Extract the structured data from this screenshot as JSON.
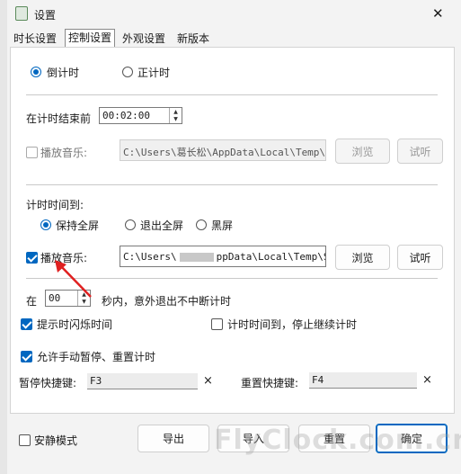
{
  "window": {
    "title": "设置",
    "close_glyph": "✕"
  },
  "tabs": [
    "时长设置",
    "控制设置",
    "外观设置",
    "新版本"
  ],
  "mode": {
    "countdown": "倒计时",
    "countup": "正计时",
    "selected": "countdown"
  },
  "before_end": {
    "label": "在计时结束前",
    "time": "00:02:00"
  },
  "music_before": {
    "label": "播放音乐:",
    "path": "C:\\Users\\葛长松\\AppData\\Local\\Temp\\ti",
    "browse": "浏览",
    "preview": "试听",
    "checked": false
  },
  "on_end": {
    "label": "计时时间到:",
    "options": [
      "保持全屏",
      "退出全屏",
      "黑屏"
    ],
    "selected": 0,
    "music_label": "播放音乐:",
    "music_path": "C:\\Users\\",
    "music_path_tail": "ppData\\Local\\Temp\\St",
    "browse": "浏览",
    "preview": "试听",
    "music_checked": true
  },
  "inactivity": {
    "prefix": "在",
    "value": "00",
    "suffix": "秒内，意外退出不中断计时"
  },
  "options": {
    "flash": {
      "label": "提示时闪烁时间",
      "checked": true
    },
    "stop_on_end": {
      "label": "计时时间到，停止继续计时",
      "checked": false
    },
    "manual": {
      "label": "允许手动暂停、重置计时",
      "checked": true
    }
  },
  "hotkeys": {
    "pause_label": "暂停快捷键:",
    "pause_value": "F3",
    "reset_label": "重置快捷键:",
    "reset_value": "F4",
    "clear_glyph": "×"
  },
  "footer": {
    "quiet_label": "安静模式",
    "quiet_checked": false,
    "export": "导出",
    "import": "导入",
    "reset": "重置",
    "ok": "确定"
  },
  "watermark": "FlyClock.com.cn"
}
